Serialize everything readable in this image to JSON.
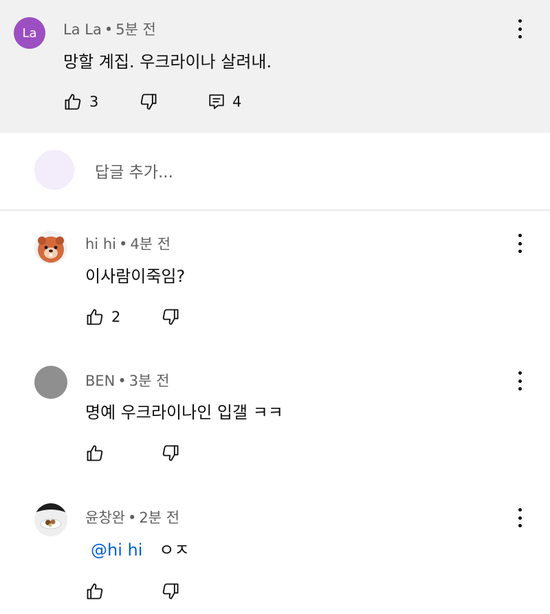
{
  "comment": {
    "avatar_letter": "La",
    "avatar_color": "#9c4fc2",
    "author": "La La",
    "time": "5분 전",
    "text": "망할 계집. 우크라이나 살려내.",
    "likes": "3",
    "replies": "4"
  },
  "reply_input": {
    "placeholder": "답글 추가..."
  },
  "replies": [
    {
      "author": "hi hi",
      "time": "4분 전",
      "text": "이사람이죽임?",
      "likes": "2"
    },
    {
      "author": "BEN",
      "time": "3분 전",
      "text": "명예 우크라이나인 입갤 ㅋㅋ",
      "likes": ""
    },
    {
      "author": "윤창완",
      "time": "2분 전",
      "mention": "@hi hi",
      "text": "ㅇㅈ",
      "likes": ""
    }
  ],
  "separator": "•",
  "colors": {
    "link": "#065fd4",
    "meta": "#606060",
    "highlight_bg": "#f1f1f1"
  },
  "icons": [
    "like-icon",
    "dislike-icon",
    "reply-count-icon",
    "more-options-icon"
  ]
}
